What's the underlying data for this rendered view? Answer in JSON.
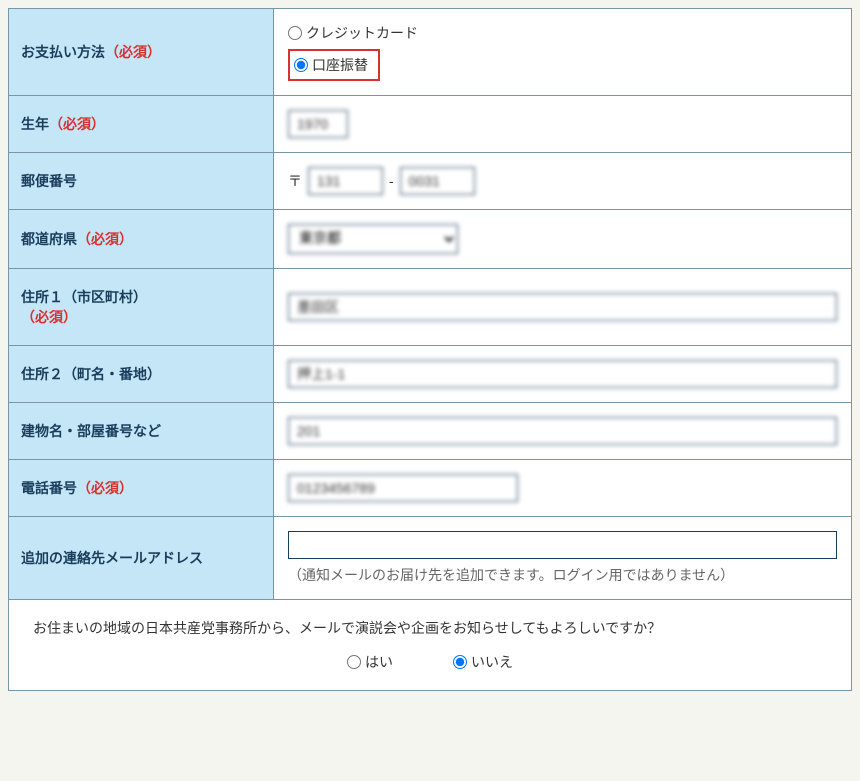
{
  "rows": {
    "payment": {
      "label": "お支払い方法",
      "required": "（必須）",
      "option_credit": "クレジットカード",
      "option_bank": "口座振替"
    },
    "birth_year": {
      "label": "生年",
      "required": "（必須）",
      "value": "1970"
    },
    "postal": {
      "label": "郵便番号",
      "prefix": "〒",
      "sep": "-",
      "value1": "131",
      "value2": "0031"
    },
    "prefecture": {
      "label": "都道府県",
      "required": "（必須）",
      "value": "東京都"
    },
    "address1": {
      "label_line1": "住所１（市区町村）",
      "required": "（必須）",
      "value": "墨田区"
    },
    "address2": {
      "label": "住所２（町名・番地）",
      "value": "押上1-1"
    },
    "building": {
      "label": "建物名・部屋番号など",
      "value": "201"
    },
    "phone": {
      "label": "電話番号",
      "required": "（必須）",
      "value": "0123456789"
    },
    "email": {
      "label": "追加の連絡先メールアドレス",
      "value": "",
      "note": "（通知メールのお届け先を追加できます。ログイン用ではありません）"
    }
  },
  "footer": {
    "question": "お住まいの地域の日本共産党事務所から、メールで演説会や企画をお知らせしてもよろしいですか？",
    "yes": "はい",
    "no": "いいえ"
  }
}
